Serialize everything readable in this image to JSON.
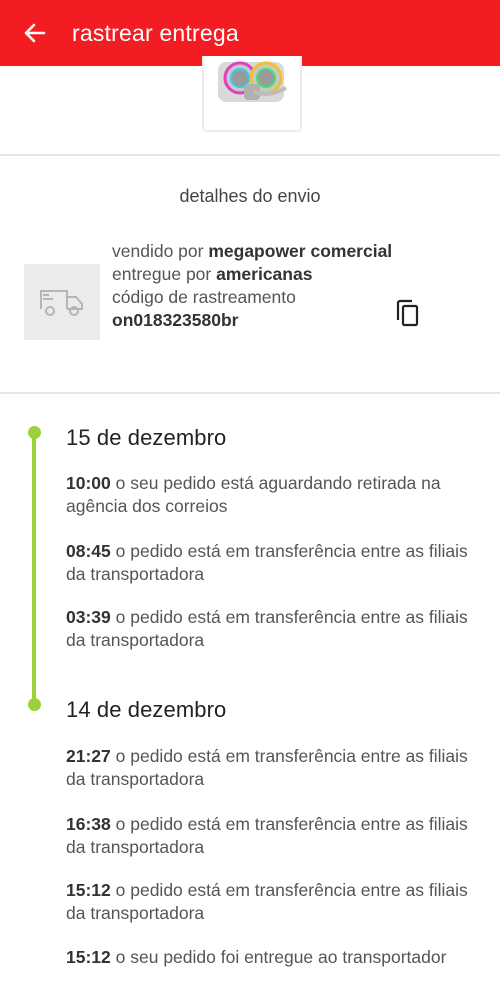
{
  "header": {
    "title": "rastrear entrega",
    "back_icon": "arrow-left-icon",
    "background_color": "#f41c23"
  },
  "shipment": {
    "section_title": "detalhes do envio",
    "sold_by_label": "vendido por",
    "seller": "megapower comercial",
    "delivered_by_label": "entregue por",
    "carrier": "americanas",
    "tracking_label": "código de rastreamento",
    "tracking_code": "on018323580br",
    "truck_icon": "truck-icon",
    "copy_icon": "copy-icon"
  },
  "timeline": {
    "accent_color": "#9bd13a",
    "days": [
      {
        "date": "15 de dezembro",
        "events": [
          {
            "time": "10:00",
            "text": "o seu pedido está aguardando retirada na agência dos correios"
          },
          {
            "time": "08:45",
            "text": "o pedido está em transferência entre as filiais da transportadora"
          },
          {
            "time": "03:39",
            "text": "o pedido está em transferência entre as filiais da transportadora"
          }
        ]
      },
      {
        "date": "14 de dezembro",
        "events": [
          {
            "time": "21:27",
            "text": "o pedido está em transferência entre as filiais da transportadora"
          },
          {
            "time": "16:38",
            "text": "o pedido está em transferência entre as filiais da transportadora"
          },
          {
            "time": "15:12",
            "text": "o pedido está em transferência entre as filiais da transportadora"
          },
          {
            "time": "15:12",
            "text": "o seu pedido foi entregue ao transportador"
          }
        ]
      }
    ]
  }
}
